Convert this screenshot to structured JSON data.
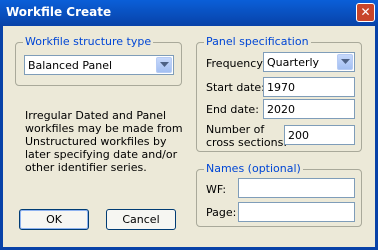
{
  "window": {
    "title": "Workfile Create",
    "close_glyph": "✕"
  },
  "structure": {
    "group_label": "Workfile structure type",
    "selected": "Balanced Panel",
    "note": "Irregular Dated and Panel workfiles may be made from Unstructured workfiles by later specifying date and/or other identifier series."
  },
  "panel": {
    "group_label": "Panel specification",
    "frequency_label": "Frequency:",
    "frequency_selected": "Quarterly",
    "start_label": "Start date:",
    "start_value": "1970",
    "end_label": "End date:",
    "end_value": "2020",
    "cross_label_line1": "Number of",
    "cross_label_line2": "cross sections:",
    "cross_value": "200"
  },
  "names": {
    "group_label": "Names (optional)",
    "wf_label": "WF:",
    "wf_value": "",
    "page_label": "Page:",
    "page_value": ""
  },
  "buttons": {
    "ok": "OK",
    "cancel": "Cancel"
  }
}
